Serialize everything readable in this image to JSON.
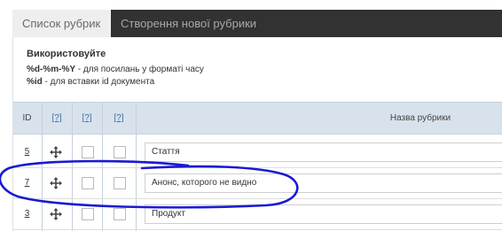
{
  "tabs": [
    {
      "label": "Список рубрик",
      "active": true
    },
    {
      "label": "Створення нової рубрики",
      "active": false
    }
  ],
  "info": {
    "heading": "Використовуйте",
    "lines": [
      {
        "code": "%d-%m-%Y",
        "text": " - для посилань у форматі часу"
      },
      {
        "code": "%id",
        "text": " - для вставки id документа"
      }
    ]
  },
  "table": {
    "headers": {
      "id": "ID",
      "help1": "[?]",
      "help2": "[?]",
      "help3": "[?]",
      "name": "Назва рубрики"
    },
    "rows": [
      {
        "id": "5",
        "name": "Стаття"
      },
      {
        "id": "7",
        "name": "Анонс, которого не видно"
      },
      {
        "id": "3",
        "name": "Продукт"
      }
    ]
  },
  "icons": {
    "move": "move-arrows-icon"
  },
  "colors": {
    "tabbar_bg": "#323232",
    "header_bg": "#d8e2ec",
    "annotation": "#1a1ad0"
  }
}
